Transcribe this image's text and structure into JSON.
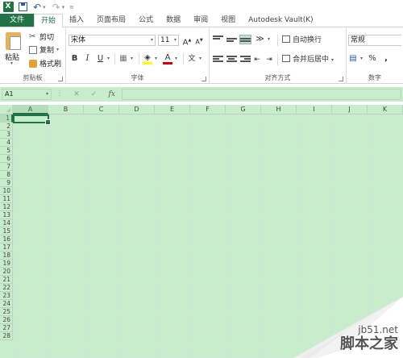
{
  "qat": {
    "app_icon": "X",
    "icons": [
      "excel-logo-icon",
      "save-icon",
      "undo-icon",
      "redo-icon"
    ]
  },
  "tabs": [
    {
      "label": "文件",
      "kind": "file"
    },
    {
      "label": "开始",
      "kind": "active"
    },
    {
      "label": "插入"
    },
    {
      "label": "页面布局"
    },
    {
      "label": "公式"
    },
    {
      "label": "数据"
    },
    {
      "label": "审阅"
    },
    {
      "label": "视图"
    },
    {
      "label": "Autodesk Vault(K)"
    }
  ],
  "clipboard": {
    "paste": "粘贴",
    "cut": "剪切",
    "copy": "复制",
    "format_painter": "格式刷",
    "group": "剪贴板"
  },
  "font": {
    "name": "宋体",
    "size": "11",
    "grow": "A",
    "shrink": "A",
    "bold": "B",
    "italic": "I",
    "underline": "U",
    "font_color": "A",
    "phonetic": "文",
    "group": "字体"
  },
  "alignment": {
    "wrap": "自动换行",
    "merge": "合并后居中",
    "group": "对齐方式"
  },
  "number": {
    "format": "常规",
    "percent": "%",
    "comma": ",",
    "group": "数字"
  },
  "formula_bar": {
    "name_box": "A1",
    "cancel": "✕",
    "enter": "✓",
    "fx": "fx"
  },
  "grid": {
    "columns": [
      "A",
      "B",
      "C",
      "D",
      "E",
      "F",
      "G",
      "H",
      "I",
      "J",
      "K"
    ],
    "rows": [
      "1",
      "2",
      "3",
      "4",
      "5",
      "6",
      "7",
      "8",
      "9",
      "10",
      "11",
      "12",
      "13",
      "14",
      "15",
      "16",
      "17",
      "18",
      "19",
      "20",
      "21",
      "22",
      "23",
      "24",
      "25",
      "26",
      "27",
      "28"
    ],
    "active_col": "A",
    "active_row": "1"
  },
  "watermark": {
    "site": "jb51.net",
    "name": "脚本之家"
  },
  "colors": {
    "excel_green": "#217346",
    "sheet_bg": "#c7edcc"
  }
}
